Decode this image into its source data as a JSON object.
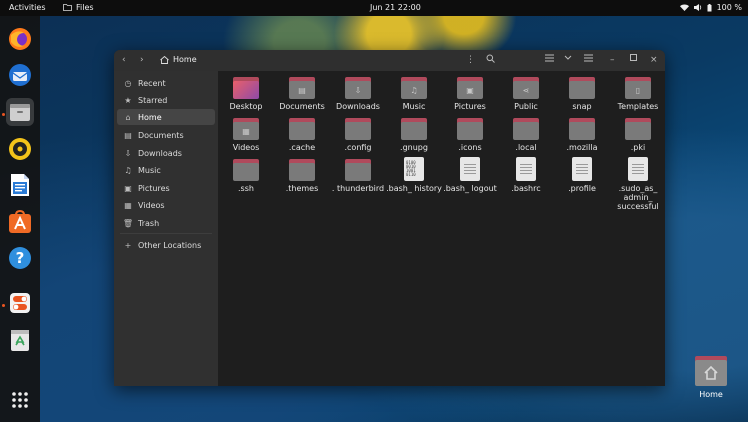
{
  "topbar": {
    "activities": "Activities",
    "app_name": "Files",
    "clock": "Jun 21  22:00",
    "battery": "100 %"
  },
  "dock": {
    "items": [
      {
        "name": "Firefox",
        "icon": "firefox-icon"
      },
      {
        "name": "Thunderbird",
        "icon": "thunderbird-icon"
      },
      {
        "name": "Files",
        "icon": "files-icon"
      },
      {
        "name": "Rhythmbox",
        "icon": "rhythmbox-icon"
      },
      {
        "name": "LibreOffice Writer",
        "icon": "writer-icon"
      },
      {
        "name": "Ubuntu Software",
        "icon": "software-icon"
      },
      {
        "name": "Help",
        "icon": "help-icon"
      },
      {
        "name": "Settings",
        "icon": "settings-icon"
      },
      {
        "name": "Trash",
        "icon": "trash-icon"
      },
      {
        "name": "Show Applications",
        "icon": "app-grid-icon"
      }
    ]
  },
  "window": {
    "title": "Home"
  },
  "sidebar": {
    "items": [
      {
        "label": "Recent",
        "icon": "clock-icon"
      },
      {
        "label": "Starred",
        "icon": "star-icon"
      },
      {
        "label": "Home",
        "icon": "home-icon"
      },
      {
        "label": "Documents",
        "icon": "document-icon"
      },
      {
        "label": "Downloads",
        "icon": "download-icon"
      },
      {
        "label": "Music",
        "icon": "music-icon"
      },
      {
        "label": "Pictures",
        "icon": "picture-icon"
      },
      {
        "label": "Videos",
        "icon": "video-icon"
      },
      {
        "label": "Trash",
        "icon": "trash-icon"
      },
      {
        "label": "Other Locations",
        "icon": "plus-icon"
      }
    ]
  },
  "files": [
    {
      "name": "Desktop",
      "kind": "folder"
    },
    {
      "name": "Documents",
      "kind": "folder"
    },
    {
      "name": "Downloads",
      "kind": "folder"
    },
    {
      "name": "Music",
      "kind": "folder"
    },
    {
      "name": "Pictures",
      "kind": "folder"
    },
    {
      "name": "Public",
      "kind": "folder"
    },
    {
      "name": "snap",
      "kind": "folder"
    },
    {
      "name": "Templates",
      "kind": "folder"
    },
    {
      "name": "Videos",
      "kind": "folder"
    },
    {
      "name": ".cache",
      "kind": "folder"
    },
    {
      "name": ".config",
      "kind": "folder"
    },
    {
      "name": ".gnupg",
      "kind": "folder"
    },
    {
      "name": ".icons",
      "kind": "folder"
    },
    {
      "name": ".local",
      "kind": "folder"
    },
    {
      "name": ".mozilla",
      "kind": "folder"
    },
    {
      "name": ".pki",
      "kind": "folder"
    },
    {
      "name": ".ssh",
      "kind": "folder"
    },
    {
      "name": ".themes",
      "kind": "folder"
    },
    {
      "name": ". thunderbird",
      "kind": "folder"
    },
    {
      "name": ".bash_ history",
      "kind": "binary"
    },
    {
      "name": ".bash_ logout",
      "kind": "text"
    },
    {
      "name": ".bashrc",
      "kind": "text"
    },
    {
      "name": ".profile",
      "kind": "text"
    },
    {
      "name": ".sudo_as_ admin_ successful",
      "kind": "text"
    }
  ],
  "desktop": {
    "home_label": "Home"
  }
}
